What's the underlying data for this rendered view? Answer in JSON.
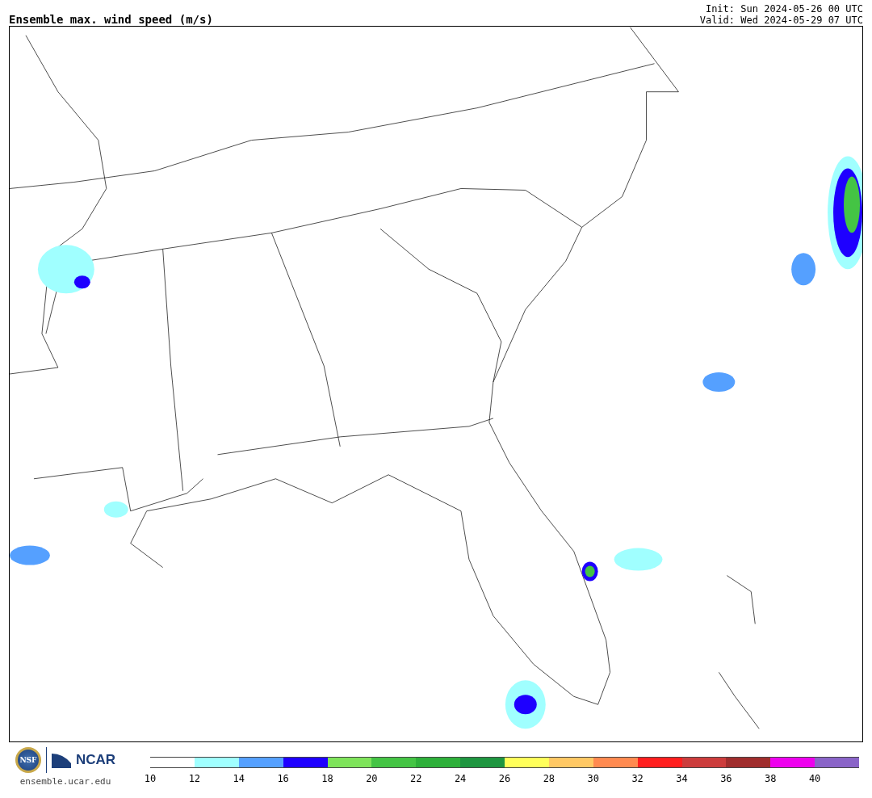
{
  "title": "Ensemble max. wind speed (m/s)",
  "init": "Init: Sun 2024-05-26 00 UTC",
  "valid": "Valid: Wed 2024-05-29 07 UTC",
  "logos": {
    "nsf": "NSF",
    "ncar": "NCAR",
    "site": "ensemble.ucar.edu"
  },
  "colorbar": [
    {
      "label": "10",
      "color": "#ffffff"
    },
    {
      "label": "12",
      "color": "#a0ffff"
    },
    {
      "label": "14",
      "color": "#55a0ff"
    },
    {
      "label": "16",
      "color": "#1e00ff"
    },
    {
      "label": "18",
      "color": "#7ee35a"
    },
    {
      "label": "20",
      "color": "#44c444"
    },
    {
      "label": "22",
      "color": "#2eb03a"
    },
    {
      "label": "24",
      "color": "#1e9640"
    },
    {
      "label": "26",
      "color": "#ffff5a"
    },
    {
      "label": "28",
      "color": "#ffc864"
    },
    {
      "label": "30",
      "color": "#ff8a50"
    },
    {
      "label": "32",
      "color": "#ff1e1e"
    },
    {
      "label": "34",
      "color": "#cc3c3c"
    },
    {
      "label": "36",
      "color": "#a02d2d"
    },
    {
      "label": "38",
      "color": "#ee00ee"
    },
    {
      "label": "40",
      "color": "#8a64c8"
    }
  ]
}
